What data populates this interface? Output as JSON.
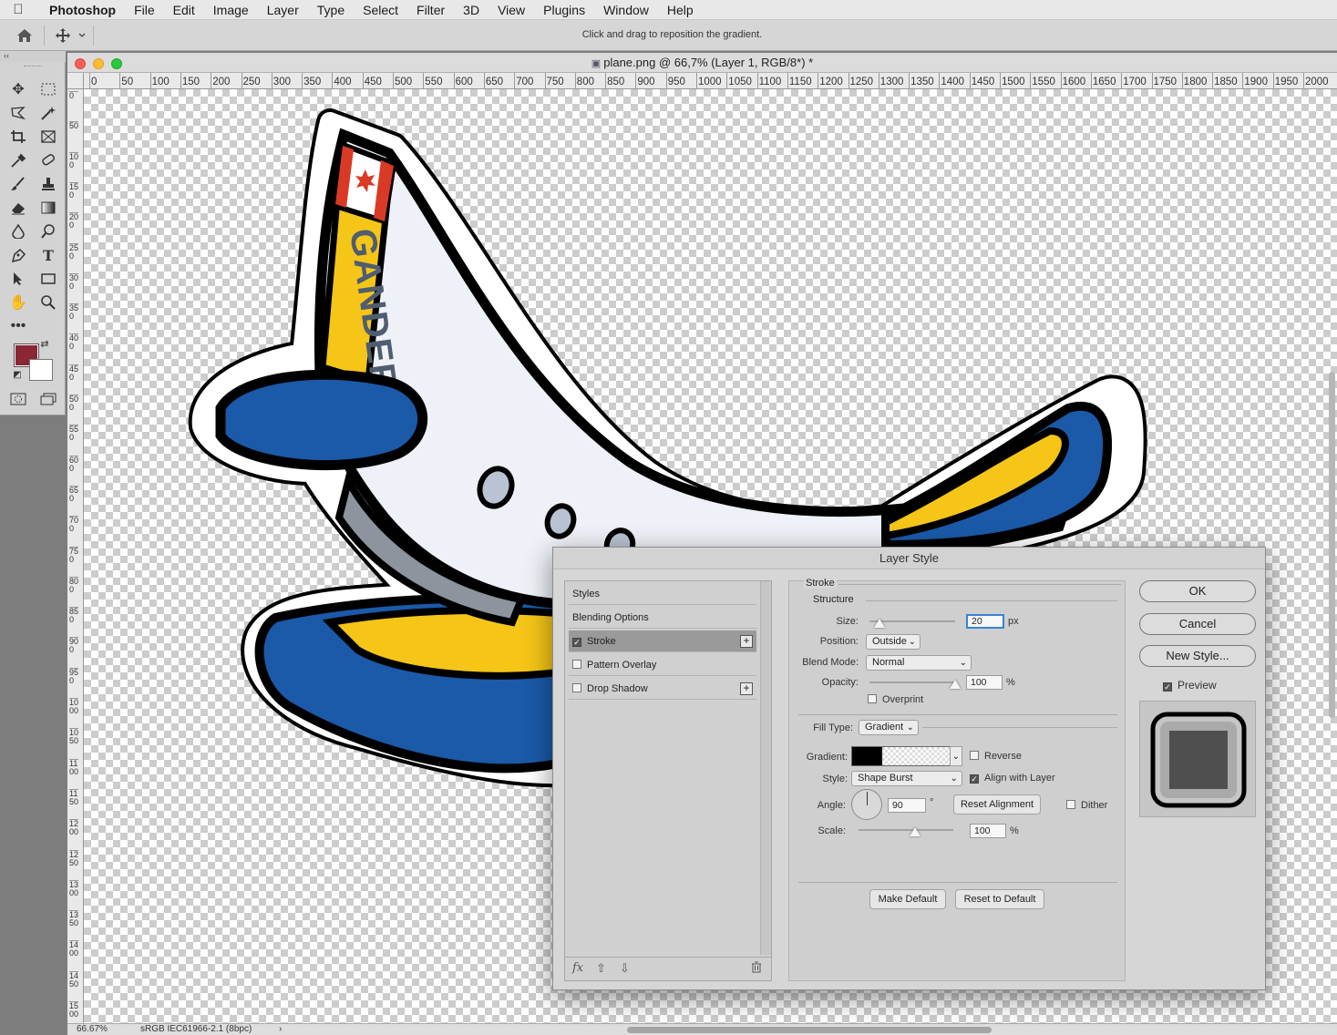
{
  "menubar": {
    "app": "Photoshop",
    "items": [
      "File",
      "Edit",
      "Image",
      "Layer",
      "Type",
      "Select",
      "Filter",
      "3D",
      "View",
      "Plugins",
      "Window",
      "Help"
    ]
  },
  "options_bar": {
    "hint": "Click and drag to reposition the gradient."
  },
  "document": {
    "title": "plane.png @ 66,7% (Layer 1, RGB/8*) *",
    "ruler_h": [
      "0",
      "50",
      "100",
      "150",
      "200",
      "250",
      "300",
      "350",
      "400",
      "450",
      "500",
      "550",
      "600",
      "650",
      "700",
      "750",
      "800",
      "850",
      "900",
      "950",
      "1000",
      "1050",
      "1100",
      "1150",
      "1200",
      "1250",
      "1300",
      "1350",
      "1400",
      "1450",
      "1500",
      "1550",
      "1600",
      "1650",
      "1700",
      "1750",
      "1800",
      "1850",
      "1900",
      "1950",
      "2000"
    ],
    "ruler_v": [
      "0",
      "50",
      "100",
      "150",
      "200",
      "250",
      "300",
      "350",
      "400",
      "450",
      "500",
      "550",
      "600",
      "650",
      "700",
      "750",
      "800",
      "850",
      "900",
      "950",
      "1000",
      "1050",
      "1100",
      "1150",
      "1200",
      "1250",
      "1300",
      "1350",
      "1400",
      "1450",
      "1500"
    ],
    "artwork_text": "GANDER",
    "status_zoom": "66.67%",
    "status_profile": "sRGB IEC61966-2.1 (8bpc)",
    "status_arrow": "›"
  },
  "colors": {
    "foreground": "#8b2634",
    "background": "#ffffff",
    "plane_body": "#eef1f7",
    "plane_blue": "#1a5aa8",
    "plane_yellow": "#f5c518",
    "plane_red": "#d93a25"
  },
  "dialog": {
    "title": "Layer Style",
    "styles_list": [
      {
        "label": "Styles",
        "checkbox": false,
        "plus": false,
        "active": false
      },
      {
        "label": "Blending Options",
        "checkbox": false,
        "plus": false,
        "active": false
      },
      {
        "label": "Stroke",
        "checkbox": true,
        "checked": true,
        "plus": true,
        "active": true
      },
      {
        "label": "Pattern Overlay",
        "checkbox": true,
        "checked": false,
        "plus": false,
        "active": false
      },
      {
        "label": "Drop Shadow",
        "checkbox": true,
        "checked": false,
        "plus": true,
        "active": false
      }
    ],
    "footer_icons": [
      "fx-icon",
      "move-up-icon",
      "move-down-icon",
      "trash-icon"
    ],
    "footer_fx": "fx",
    "section_title": "Stroke",
    "structure": {
      "title": "Structure",
      "size_label": "Size:",
      "size_value": "20",
      "size_unit": "px",
      "size_slider": 0.12,
      "position_label": "Position:",
      "position_value": "Outside",
      "blend_label": "Blend Mode:",
      "blend_value": "Normal",
      "opacity_label": "Opacity:",
      "opacity_value": "100",
      "opacity_unit": "%",
      "opacity_slider": 1.0,
      "overprint_label": "Overprint"
    },
    "fill": {
      "fill_type_label": "Fill Type:",
      "fill_type_value": "Gradient",
      "gradient_label": "Gradient:",
      "reverse_label": "Reverse",
      "style_label": "Style:",
      "style_value": "Shape Burst",
      "align_label": "Align with Layer",
      "angle_label": "Angle:",
      "angle_value": "90",
      "angle_unit": "°",
      "reset_alignment": "Reset Alignment",
      "dither_label": "Dither",
      "scale_label": "Scale:",
      "scale_value": "100",
      "scale_unit": "%",
      "scale_slider": 0.6
    },
    "make_default": "Make Default",
    "reset_default": "Reset to Default",
    "ok": "OK",
    "cancel": "Cancel",
    "new_style": "New Style...",
    "preview_label": "Preview"
  }
}
